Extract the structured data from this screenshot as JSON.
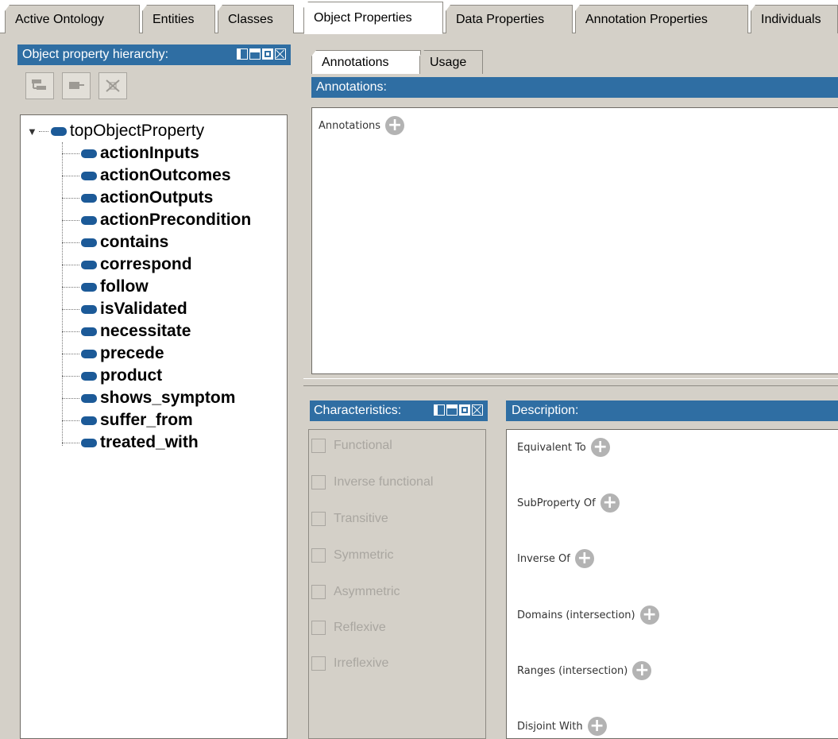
{
  "tabs": [
    {
      "label": "Active Ontology"
    },
    {
      "label": "Entities"
    },
    {
      "label": "Classes"
    },
    {
      "label": "Object Properties"
    },
    {
      "label": "Data Properties"
    },
    {
      "label": "Annotation Properties"
    },
    {
      "label": "Individuals"
    }
  ],
  "hierarchy": {
    "title": "Object property hierarchy:",
    "root": "topObjectProperty",
    "items": [
      "actionInputs",
      "actionOutcomes",
      "actionOutputs",
      "actionPrecondition",
      "contains",
      "correspond",
      "follow",
      "isValidated",
      "necessitate",
      "precede",
      "product",
      "shows_symptom",
      "suffer_from",
      "treated_with"
    ]
  },
  "sub_tabs": [
    {
      "label": "Annotations"
    },
    {
      "label": "Usage"
    }
  ],
  "annotations": {
    "header": "Annotations:",
    "label": "Annotations"
  },
  "characteristics": {
    "header": "Characteristics:",
    "items": [
      "Functional",
      "Inverse functional",
      "Transitive",
      "Symmetric",
      "Asymmetric",
      "Reflexive",
      "Irreflexive"
    ]
  },
  "description": {
    "header": "Description:",
    "items": [
      "Equivalent To",
      "SubProperty Of",
      "Inverse Of",
      "Domains (intersection)",
      "Ranges (intersection)",
      "Disjoint With"
    ]
  },
  "colors": {
    "header_blue": "#2f6ea3",
    "property_icon": "#1c5a98"
  }
}
